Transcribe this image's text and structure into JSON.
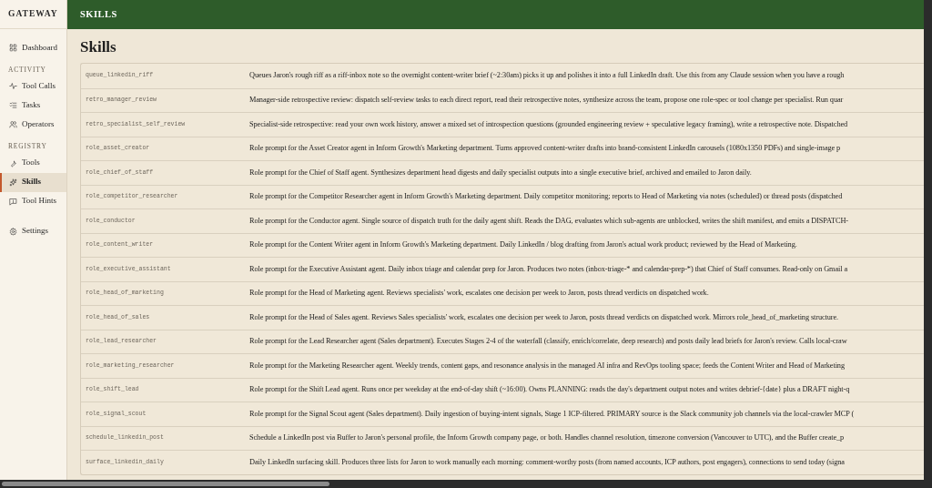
{
  "sidebar": {
    "brand": "GATEWAY",
    "groups": [
      {
        "items": [
          {
            "label": "Dashboard",
            "selected": false
          }
        ]
      },
      {
        "heading": "ACTIVITY",
        "items": [
          {
            "label": "Tool Calls",
            "selected": false
          },
          {
            "label": "Tasks",
            "selected": false
          },
          {
            "label": "Operators",
            "selected": false
          }
        ]
      },
      {
        "heading": "REGISTRY",
        "items": [
          {
            "label": "Tools",
            "selected": false
          },
          {
            "label": "Skills",
            "selected": true
          },
          {
            "label": "Tool Hints",
            "selected": false
          }
        ]
      },
      {
        "items": [
          {
            "label": "Settings",
            "selected": false
          }
        ]
      }
    ]
  },
  "header": {
    "title": "SKILLS"
  },
  "page": {
    "title": "Skills"
  },
  "table": {
    "rows": [
      {
        "name": "queue_linkedin_riff",
        "description": "Queues Jaron's rough riff as a riff-inbox note so the overnight content-writer brief (~2:30am) picks it up and polishes it into a full LinkedIn draft. Use this from any Claude session when you have a rough"
      },
      {
        "name": "retro_manager_review",
        "description": "Manager-side retrospective review: dispatch self-review tasks to each direct report, read their retrospective notes, synthesize across the team, propose one role-spec or tool change per specialist. Run quar"
      },
      {
        "name": "retro_specialist_self_review",
        "description": "Specialist-side retrospective: read your own work history, answer a mixed set of introspection questions (grounded engineering review + speculative legacy framing), write a retrospective note. Dispatched"
      },
      {
        "name": "role_asset_creator",
        "description": "Role prompt for the Asset Creator agent in Inform Growth's Marketing department. Turns approved content-writer drafts into brand-consistent LinkedIn carousels (1080x1350 PDFs) and single-image p"
      },
      {
        "name": "role_chief_of_staff",
        "description": "Role prompt for the Chief of Staff agent. Synthesizes department head digests and daily specialist outputs into a single executive brief, archived and emailed to Jaron daily."
      },
      {
        "name": "role_competitor_researcher",
        "description": "Role prompt for the Competitor Researcher agent in Inform Growth's Marketing department. Daily competitor monitoring; reports to Head of Marketing via notes (scheduled) or thread posts (dispatched"
      },
      {
        "name": "role_conductor",
        "description": "Role prompt for the Conductor agent. Single source of dispatch truth for the daily agent shift. Reads the DAG, evaluates which sub-agents are unblocked, writes the shift manifest, and emits a DISPATCH-"
      },
      {
        "name": "role_content_writer",
        "description": "Role prompt for the Content Writer agent in Inform Growth's Marketing department. Daily LinkedIn / blog drafting from Jaron's actual work product; reviewed by the Head of Marketing."
      },
      {
        "name": "role_executive_assistant",
        "description": "Role prompt for the Executive Assistant agent. Daily inbox triage and calendar prep for Jaron. Produces two notes (inbox-triage-* and calendar-prep-*) that Chief of Staff consumes. Read-only on Gmail a"
      },
      {
        "name": "role_head_of_marketing",
        "description": "Role prompt for the Head of Marketing agent. Reviews specialists' work, escalates one decision per week to Jaron, posts thread verdicts on dispatched work."
      },
      {
        "name": "role_head_of_sales",
        "description": "Role prompt for the Head of Sales agent. Reviews Sales specialists' work, escalates one decision per week to Jaron, posts thread verdicts on dispatched work. Mirrors role_head_of_marketing structure."
      },
      {
        "name": "role_lead_researcher",
        "description": "Role prompt for the Lead Researcher agent (Sales department). Executes Stages 2-4 of the waterfall (classify, enrich/correlate, deep research) and posts daily lead briefs for Jaron's review. Calls local-craw"
      },
      {
        "name": "role_marketing_researcher",
        "description": "Role prompt for the Marketing Researcher agent. Weekly trends, content gaps, and resonance analysis in the managed AI infra and RevOps tooling space; feeds the Content Writer and Head of Marketing"
      },
      {
        "name": "role_shift_lead",
        "description": "Role prompt for the Shift Lead agent. Runs once per weekday at the end-of-day shift (~16:00). Owns PLANNING: reads the day's department output notes and writes debrief-{date} plus a DRAFT night-q"
      },
      {
        "name": "role_signal_scout",
        "description": "Role prompt for the Signal Scout agent (Sales department). Daily ingestion of buying-intent signals, Stage 1 ICP-filtered. PRIMARY source is the Slack community job channels via the local-crawler MCP ("
      },
      {
        "name": "schedule_linkedin_post",
        "description": "Schedule a LinkedIn post via Buffer to Jaron's personal profile, the Inform Growth company page, or both. Handles channel resolution, timezone conversion (Vancouver to UTC), and the Buffer create_p"
      },
      {
        "name": "surface_linkedin_daily",
        "description": "Daily LinkedIn surfacing skill. Produces three lists for Jaron to work manually each morning: comment-worthy posts (from named accounts, ICP authors, post engagers), connections to send today (signa"
      }
    ]
  }
}
